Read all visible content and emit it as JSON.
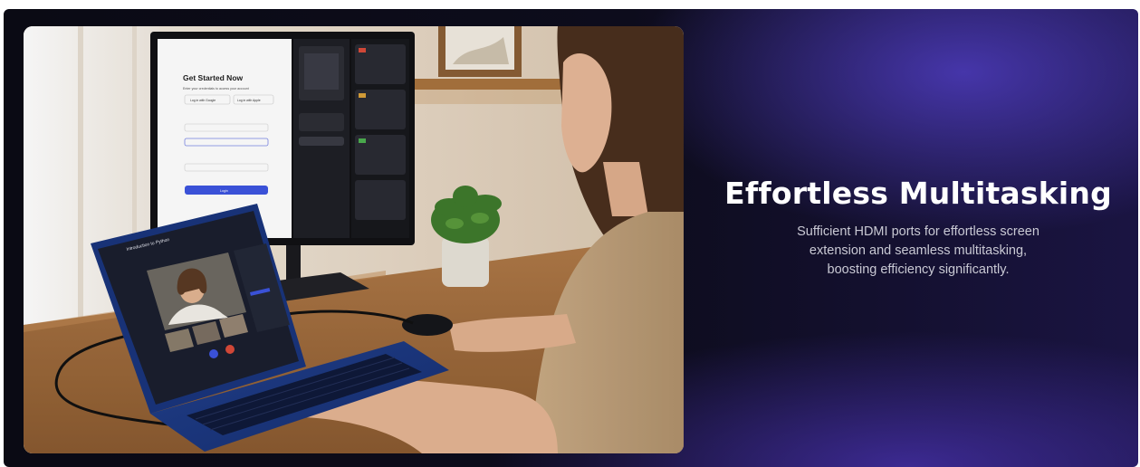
{
  "hero": {
    "title": "Effortless Multitasking",
    "description_lines": [
      "Sufficient HDMI ports for effortless screen",
      "extension and seamless multitasking,",
      "boosting efficiency significantly."
    ],
    "image_label": "Woman working at a desk with a laptop connected to an external monitor",
    "colors": {
      "background_dark": "#0a0a14",
      "background_glow": "#4e3cbe",
      "title_text": "#ffffff",
      "body_text": "#c9c9d4",
      "laptop_body": "#1d3a8a"
    }
  },
  "monitor_screen": {
    "heading": "Get Started Now",
    "subheading": "Enter your credentials to access your account",
    "google_button": "Log in with Google",
    "apple_button": "Log in with Apple",
    "submit_button": "Login"
  },
  "laptop_screen": {
    "meeting_title": "Introduction to Python"
  }
}
